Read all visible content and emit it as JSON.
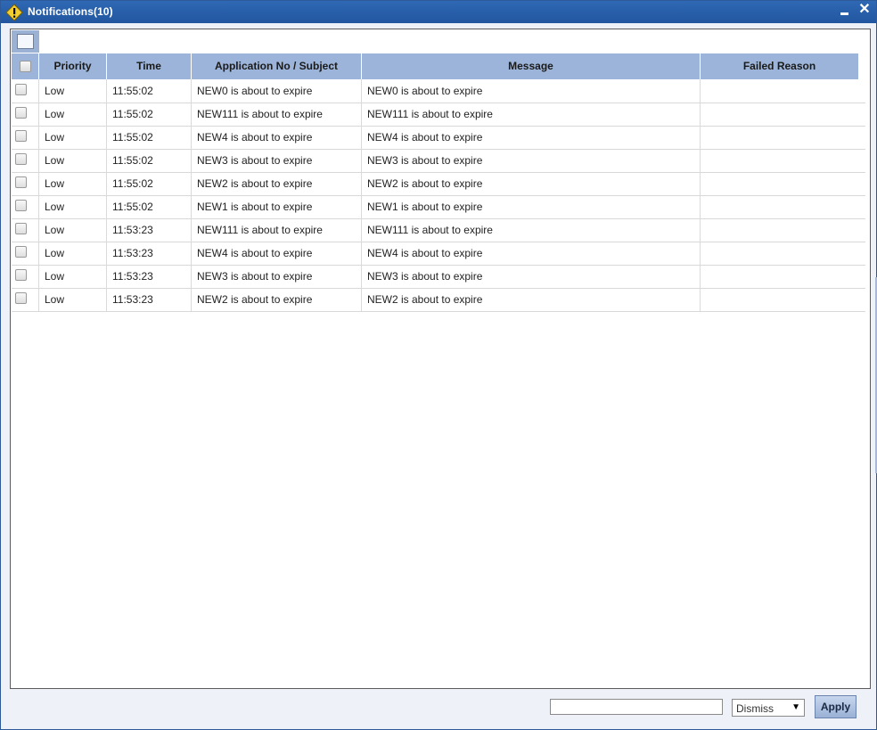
{
  "window": {
    "title": "Notifications(10)",
    "minimize_icon": "minimize-icon",
    "close_label": "✕"
  },
  "grid": {
    "headers": [
      "",
      "Priority",
      "Time",
      "Application No / Subject",
      "Message",
      "Failed Reason"
    ],
    "rows": [
      {
        "priority": "Low",
        "time": "11:55:02",
        "subject": "NEW0 is about to expire",
        "message": "NEW0 is about to expire",
        "failed_reason": ""
      },
      {
        "priority": "Low",
        "time": "11:55:02",
        "subject": "NEW111 is about to expire",
        "message": "NEW111 is about to expire",
        "failed_reason": ""
      },
      {
        "priority": "Low",
        "time": "11:55:02",
        "subject": "NEW4 is about to expire",
        "message": "NEW4 is about to expire",
        "failed_reason": ""
      },
      {
        "priority": "Low",
        "time": "11:55:02",
        "subject": "NEW3 is about to expire",
        "message": "NEW3 is about to expire",
        "failed_reason": ""
      },
      {
        "priority": "Low",
        "time": "11:55:02",
        "subject": "NEW2 is about to expire",
        "message": "NEW2 is about to expire",
        "failed_reason": ""
      },
      {
        "priority": "Low",
        "time": "11:55:02",
        "subject": "NEW1 is about to expire",
        "message": "NEW1 is about to expire",
        "failed_reason": ""
      },
      {
        "priority": "Low",
        "time": "11:53:23",
        "subject": "NEW111 is about to expire",
        "message": "NEW111 is about to expire",
        "failed_reason": ""
      },
      {
        "priority": "Low",
        "time": "11:53:23",
        "subject": "NEW4 is about to expire",
        "message": "NEW4 is about to expire",
        "failed_reason": ""
      },
      {
        "priority": "Low",
        "time": "11:53:23",
        "subject": "NEW3 is about to expire",
        "message": "NEW3 is about to expire",
        "failed_reason": ""
      },
      {
        "priority": "Low",
        "time": "11:53:23",
        "subject": "NEW2 is about to expire",
        "message": "NEW2 is about to expire",
        "failed_reason": ""
      }
    ]
  },
  "footer": {
    "input_value": "",
    "action_select": "Dismiss",
    "apply_label": "Apply"
  },
  "colors": {
    "titlebar": "#2f68b4",
    "header": "#9cb4d9",
    "apply_button": "#9ab1d6"
  }
}
